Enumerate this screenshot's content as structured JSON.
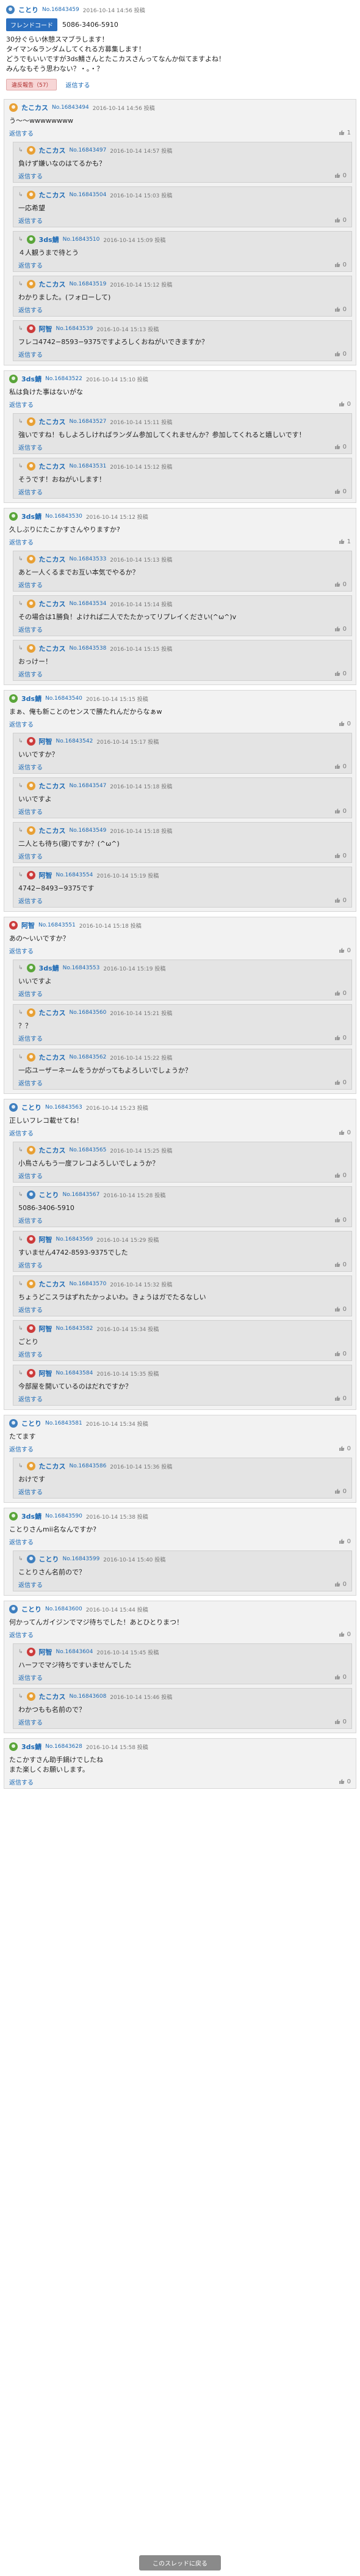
{
  "colors": {
    "link": "#1d6ab5",
    "fc_badge": "#2b6fbf",
    "reply_bg": "#f2f2f2",
    "sub_bg": "#e4e4e4",
    "delete_bg": "#f7d6d6"
  },
  "post": {
    "user": "ことり",
    "avatar": "blue",
    "post_id": "No.16843459",
    "date": "2016-10-14 14:56 投稿",
    "fc_badge": "フレンドコード",
    "fc_code": "5086-3406-5910",
    "body": "30分ぐらい休憩スマブラします！\nタイマン&ランダムしてくれる方募集します！\nどうでもいいですが3ds鯖さんとたこカスさんってなんか似てますよね！\nみんなもそう思わない？・。・？",
    "delete_label": "違反報告（57）",
    "reply_label": "返信する"
  },
  "threads": [
    {
      "user": "たこカス",
      "avatar": "orange",
      "post_id": "No.16843494",
      "date": "2016-10-14 14:56 投稿",
      "body": "う〜〜wwwwwwww",
      "reply_label": "返信する",
      "likes": "1",
      "subs": [
        {
          "user": "たこカス",
          "avatar": "orange",
          "post_id": "No.16843497",
          "date": "2016-10-14 14:57 投稿",
          "body": "負けず嫌いなのはてるかも？",
          "reply_label": "返信する",
          "likes": "0"
        },
        {
          "user": "たこカス",
          "avatar": "orange",
          "post_id": "No.16843504",
          "date": "2016-10-14 15:03 投稿",
          "body": "一応希望",
          "reply_label": "返信する",
          "likes": "0"
        },
        {
          "user": "3ds鯖",
          "avatar": "green",
          "post_id": "No.16843510",
          "date": "2016-10-14 15:09 投稿",
          "body": "４人観うまで待とう",
          "reply_label": "返信する",
          "likes": "0"
        },
        {
          "user": "たこカス",
          "avatar": "orange",
          "post_id": "No.16843519",
          "date": "2016-10-14 15:12 投稿",
          "body": "わかりました。(フォローして)",
          "reply_label": "返信する",
          "likes": "0"
        },
        {
          "user": "阿智",
          "avatar": "red",
          "post_id": "No.16843539",
          "date": "2016-10-14 15:13 投稿",
          "body": "フレコ4742−8593−9375ですよろしくおねがいできますか？",
          "reply_label": "返信する",
          "likes": "0"
        }
      ]
    },
    {
      "user": "3ds鯖",
      "avatar": "green",
      "post_id": "No.16843522",
      "date": "2016-10-14 15:10 投稿",
      "body": "私は負けた事はないがな",
      "reply_label": "返信する",
      "likes": "0",
      "subs": [
        {
          "user": "たこカス",
          "avatar": "orange",
          "post_id": "No.16843527",
          "date": "2016-10-14 15:11 投稿",
          "body": "強いですね！もしよろしければランダム参加してくれませんか？参加してくれると嬉しいです！",
          "reply_label": "返信する",
          "likes": "0"
        },
        {
          "user": "たこカス",
          "avatar": "orange",
          "post_id": "No.16843531",
          "date": "2016-10-14 15:12 投稿",
          "body": "そうです！おねがいします！",
          "reply_label": "返信する",
          "likes": "0"
        }
      ]
    },
    {
      "user": "3ds鯖",
      "avatar": "green",
      "post_id": "No.16843530",
      "date": "2016-10-14 15:12 投稿",
      "body": "久しぶりにたこかすさんやりますか?",
      "reply_label": "返信する",
      "likes": "1",
      "subs": [
        {
          "user": "たこカス",
          "avatar": "orange",
          "post_id": "No.16843533",
          "date": "2016-10-14 15:13 投稿",
          "body": "あと一人くるまでお互い本気でやるか？",
          "reply_label": "返信する",
          "likes": "0"
        },
        {
          "user": "たこカス",
          "avatar": "orange",
          "post_id": "No.16843534",
          "date": "2016-10-14 15:14 投稿",
          "body": "その場合は1勝負！よければ二人でたたかってリプレイください(^ω^)v",
          "reply_label": "返信する",
          "likes": "0"
        },
        {
          "user": "たこカス",
          "avatar": "orange",
          "post_id": "No.16843538",
          "date": "2016-10-14 15:15 投稿",
          "body": "おっけー！",
          "reply_label": "返信する",
          "likes": "0"
        }
      ]
    },
    {
      "user": "3ds鯖",
      "avatar": "green",
      "post_id": "No.16843540",
      "date": "2016-10-14 15:15 投稿",
      "body": "まぁ、俺も新ことのセンスで勝たれんだからなぁw",
      "reply_label": "返信する",
      "likes": "0",
      "subs": [
        {
          "user": "阿智",
          "avatar": "red",
          "post_id": "No.16843542",
          "date": "2016-10-14 15:17 投稿",
          "body": "いいですか？",
          "reply_label": "返信する",
          "likes": "0"
        },
        {
          "user": "たこカス",
          "avatar": "orange",
          "post_id": "No.16843547",
          "date": "2016-10-14 15:18 投稿",
          "body": "いいですよ",
          "reply_label": "返信する",
          "likes": "0"
        },
        {
          "user": "たこカス",
          "avatar": "orange",
          "post_id": "No.16843549",
          "date": "2016-10-14 15:18 投稿",
          "body": "二人とも待ち(寝)ですか？(^ω^)",
          "reply_label": "返信する",
          "likes": "0"
        },
        {
          "user": "阿智",
          "avatar": "red",
          "post_id": "No.16843554",
          "date": "2016-10-14 15:19 投稿",
          "body": "4742−8493−9375です",
          "reply_label": "返信する",
          "likes": "0"
        }
      ]
    },
    {
      "user": "阿智",
      "avatar": "red",
      "post_id": "No.16843551",
      "date": "2016-10-14 15:18 投稿",
      "body": "あの〜いいですか？",
      "reply_label": "返信する",
      "likes": "0",
      "subs": [
        {
          "user": "3ds鯖",
          "avatar": "green",
          "post_id": "No.16843553",
          "date": "2016-10-14 15:19 投稿",
          "body": "いいですよ",
          "reply_label": "返信する",
          "likes": "0"
        },
        {
          "user": "たこカス",
          "avatar": "orange",
          "post_id": "No.16843560",
          "date": "2016-10-14 15:21 投稿",
          "body": "？？",
          "reply_label": "返信する",
          "likes": "0"
        },
        {
          "user": "たこカス",
          "avatar": "orange",
          "post_id": "No.16843562",
          "date": "2016-10-14 15:22 投稿",
          "body": "一応ユーザーネームをうかがってもよろしいでしょうか？",
          "reply_label": "返信する",
          "likes": "0"
        }
      ]
    },
    {
      "user": "ことり",
      "avatar": "blue",
      "post_id": "No.16843563",
      "date": "2016-10-14 15:23 投稿",
      "body": "正しいフレコ載せてね！",
      "reply_label": "返信する",
      "likes": "0",
      "subs": [
        {
          "user": "たこカス",
          "avatar": "orange",
          "post_id": "No.16843565",
          "date": "2016-10-14 15:25 投稿",
          "body": "小鳥さんもう一度フレコよろしいでしょうか？",
          "reply_label": "返信する",
          "likes": "0"
        },
        {
          "user": "ことり",
          "avatar": "blue",
          "post_id": "No.16843567",
          "date": "2016-10-14 15:28 投稿",
          "body": "5086-3406-5910",
          "reply_label": "返信する",
          "likes": "0"
        },
        {
          "user": "阿智",
          "avatar": "red",
          "post_id": "No.16843569",
          "date": "2016-10-14 15:29 投稿",
          "body": "すいません4742-8593-9375でした",
          "reply_label": "返信する",
          "likes": "0"
        },
        {
          "user": "たこカス",
          "avatar": "orange",
          "post_id": "No.16843570",
          "date": "2016-10-14 15:32 投稿",
          "body": "ちょうどこスラはずれたかっよいわ。きょうはガでたるなしい",
          "reply_label": "返信する",
          "likes": "0"
        },
        {
          "user": "阿智",
          "avatar": "red",
          "post_id": "No.16843582",
          "date": "2016-10-14 15:34 投稿",
          "body": "ごとり",
          "reply_label": "返信する",
          "likes": "0"
        },
        {
          "user": "阿智",
          "avatar": "red",
          "post_id": "No.16843584",
          "date": "2016-10-14 15:35 投稿",
          "body": "今部屋を開いているのはだれですか？",
          "reply_label": "返信する",
          "likes": "0"
        }
      ]
    },
    {
      "user": "ことり",
      "avatar": "blue",
      "post_id": "No.16843581",
      "date": "2016-10-14 15:34 投稿",
      "body": "たてます",
      "reply_label": "返信する",
      "likes": "0",
      "subs": [
        {
          "user": "たこカス",
          "avatar": "orange",
          "post_id": "No.16843586",
          "date": "2016-10-14 15:36 投稿",
          "body": "おけです",
          "reply_label": "返信する",
          "likes": "0"
        }
      ]
    },
    {
      "user": "3ds鯖",
      "avatar": "green",
      "post_id": "No.16843590",
      "date": "2016-10-14 15:38 投稿",
      "body": "ことりさんmii名なんですか?",
      "reply_label": "返信する",
      "likes": "0",
      "subs": [
        {
          "user": "ことり",
          "avatar": "blue",
          "post_id": "No.16843599",
          "date": "2016-10-14 15:40 投稿",
          "body": "ことりさん名前ので？",
          "reply_label": "返信する",
          "likes": "0"
        }
      ]
    },
    {
      "user": "ことり",
      "avatar": "blue",
      "post_id": "No.16843600",
      "date": "2016-10-14 15:44 投稿",
      "body": "何かってんガイジンでマジ待ちでした！あとひとりまつ！",
      "reply_label": "返信する",
      "likes": "0",
      "subs": [
        {
          "user": "阿智",
          "avatar": "red",
          "post_id": "No.16843604",
          "date": "2016-10-14 15:45 投稿",
          "body": "ハーフでマジ待ちですいませんでした",
          "reply_label": "返信する",
          "likes": "0"
        },
        {
          "user": "たこカス",
          "avatar": "orange",
          "post_id": "No.16843608",
          "date": "2016-10-14 15:46 投稿",
          "body": "わかつもも名前ので？",
          "reply_label": "返信する",
          "likes": "0"
        }
      ]
    },
    {
      "user": "3ds鯖",
      "avatar": "green",
      "post_id": "No.16843628",
      "date": "2016-10-14 15:58 投稿",
      "body": "たこかすさん助手鍋けでしたね\nまた楽しくお願いします。",
      "reply_label": "返信する",
      "likes": "0",
      "subs": []
    }
  ],
  "footer": {
    "back_label": "このスレッドに戻る"
  }
}
